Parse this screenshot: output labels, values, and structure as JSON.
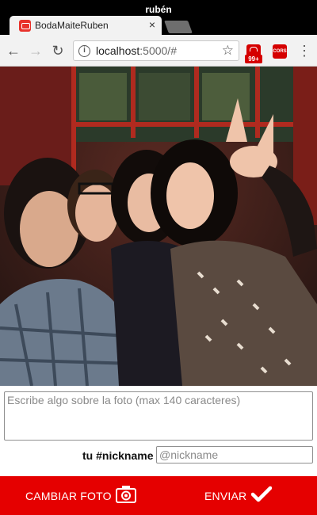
{
  "window": {
    "profile_name": "rubén",
    "tab_title": "BodaMaiteRuben",
    "tab_close": "×"
  },
  "toolbar": {
    "url_host": "localhost",
    "url_rest": ":5000/#",
    "ext_badge": "99+",
    "ext_cors_label": "CORS",
    "icons": [
      "back-arrow-icon",
      "forward-arrow-icon",
      "reload-icon",
      "info-icon",
      "star-icon",
      "extension-icon",
      "cors-extension-icon",
      "menu-icon"
    ]
  },
  "form": {
    "caption_placeholder": "Escribe algo sobre la foto (max 140 caracteres)",
    "nickname_label": "tu #nickname",
    "nickname_placeholder": "@nickname"
  },
  "actions": {
    "change_photo_label": "CAMBIAR FOTO",
    "send_label": "ENVIAR"
  },
  "colors": {
    "accent": "#e50000",
    "favicon": "#e8322b"
  }
}
